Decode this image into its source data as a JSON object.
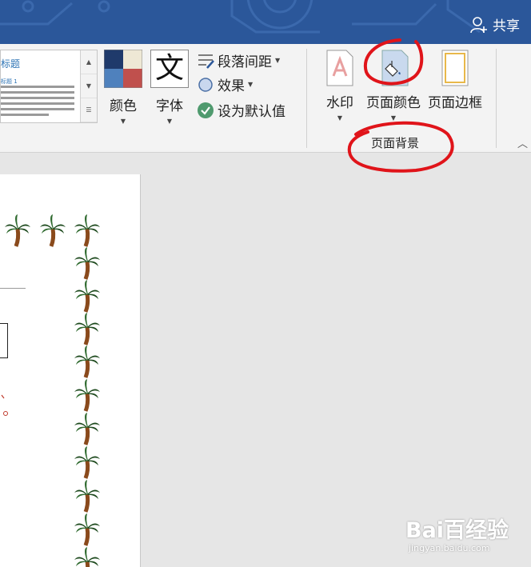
{
  "titlebar": {
    "share_label": "共享",
    "color": "#2b579a"
  },
  "ribbon": {
    "style_gallery": {
      "title_text": "标题",
      "heading_text": "标题 1"
    },
    "buttons": {
      "colors_label": "颜色",
      "fonts_label": "字体",
      "fonts_glyph": "文",
      "paragraph_spacing_label": "段落间距",
      "effects_label": "效果",
      "set_default_label": "设为默认值",
      "watermark_label": "水印",
      "page_color_label": "页面颜色",
      "page_borders_label": "页面边框"
    },
    "group_label": "页面背景"
  },
  "document": {
    "border_style": "palm-tree-art-border"
  },
  "watermark": {
    "logo_text": "Bai百经验",
    "sub_text": "jingyan.baidu.com"
  },
  "annotations": {
    "color": "#e0141a"
  }
}
